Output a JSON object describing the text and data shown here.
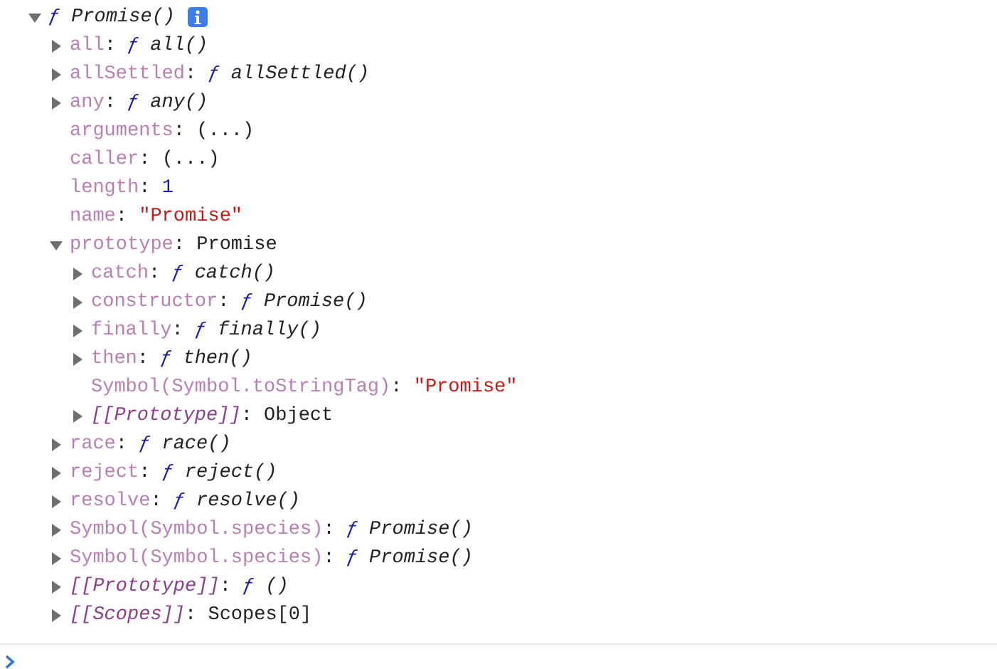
{
  "tree": {
    "marker": "ƒ",
    "value": "Promise()",
    "kind": "function",
    "expanded": true,
    "children": [
      {
        "key": "all",
        "internal": false,
        "sep": ": ",
        "kind": "function",
        "marker": "ƒ",
        "value": "all()",
        "expanded": false
      },
      {
        "key": "allSettled",
        "internal": false,
        "sep": ": ",
        "kind": "function",
        "marker": "ƒ",
        "value": "allSettled()",
        "expanded": false
      },
      {
        "key": "any",
        "internal": false,
        "sep": ": ",
        "kind": "function",
        "marker": "ƒ",
        "value": "any()",
        "expanded": false
      },
      {
        "key": "arguments",
        "internal": false,
        "sep": ": ",
        "kind": "accessor",
        "value": "(...)"
      },
      {
        "key": "caller",
        "internal": false,
        "sep": ": ",
        "kind": "accessor",
        "value": "(...)"
      },
      {
        "key": "length",
        "internal": false,
        "sep": ": ",
        "kind": "number",
        "value": "1"
      },
      {
        "key": "name",
        "internal": false,
        "sep": ": ",
        "kind": "string",
        "value": "\"Promise\""
      },
      {
        "key": "prototype",
        "internal": false,
        "sep": ": ",
        "kind": "object",
        "value": "Promise",
        "expanded": true,
        "children": [
          {
            "key": "catch",
            "internal": false,
            "sep": ": ",
            "kind": "function",
            "marker": "ƒ",
            "value": "catch()",
            "expanded": false
          },
          {
            "key": "constructor",
            "internal": false,
            "sep": ": ",
            "kind": "function",
            "marker": "ƒ",
            "value": "Promise()",
            "expanded": false
          },
          {
            "key": "finally",
            "internal": false,
            "sep": ": ",
            "kind": "function",
            "marker": "ƒ",
            "value": "finally()",
            "expanded": false
          },
          {
            "key": "then",
            "internal": false,
            "sep": ": ",
            "kind": "function",
            "marker": "ƒ",
            "value": "then()",
            "expanded": false
          },
          {
            "key": "Symbol(Symbol.toStringTag)",
            "internal": false,
            "sep": ": ",
            "kind": "string",
            "value": "\"Promise\""
          },
          {
            "key": "[[Prototype]]",
            "internal": true,
            "sep": ": ",
            "kind": "object",
            "value": "Object",
            "expanded": false
          }
        ]
      },
      {
        "key": "race",
        "internal": false,
        "sep": ": ",
        "kind": "function",
        "marker": "ƒ",
        "value": "race()",
        "expanded": false
      },
      {
        "key": "reject",
        "internal": false,
        "sep": ": ",
        "kind": "function",
        "marker": "ƒ",
        "value": "reject()",
        "expanded": false
      },
      {
        "key": "resolve",
        "internal": false,
        "sep": ": ",
        "kind": "function",
        "marker": "ƒ",
        "value": "resolve()",
        "expanded": false
      },
      {
        "key": "Symbol(Symbol.species)",
        "internal": false,
        "sep": ": ",
        "kind": "function",
        "marker": "ƒ",
        "value": "Promise()",
        "expanded": false
      },
      {
        "key": "Symbol(Symbol.species)",
        "internal": false,
        "sep": ": ",
        "kind": "function",
        "marker": "ƒ",
        "value": "Promise()",
        "expanded": false
      },
      {
        "key": "[[Prototype]]",
        "internal": true,
        "sep": ": ",
        "kind": "function",
        "marker": "ƒ",
        "value": "()",
        "expanded": false
      },
      {
        "key": "[[Scopes]]",
        "internal": true,
        "sep": ": ",
        "kind": "object",
        "value": "Scopes[0]",
        "expanded": false
      }
    ]
  }
}
